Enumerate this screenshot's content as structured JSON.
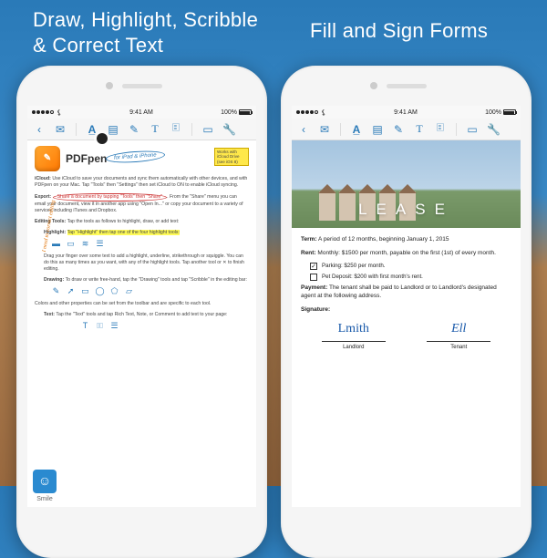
{
  "headlines": {
    "left": "Draw, Highlight, Scribble\n& Correct Text",
    "right": "Fill and Sign Forms"
  },
  "statusbar": {
    "time": "9:41 AM",
    "battery": "100%"
  },
  "toolbar": {
    "items": [
      "back",
      "mail",
      "text-style",
      "highlight",
      "pen",
      "text-tool",
      "note",
      "ruler",
      "wrench"
    ]
  },
  "doc_left": {
    "app_name": "PDFpen",
    "handwritten_tag": "for iPad & iPhone",
    "badge": "Works with iCloud Drive (see iOS 8)",
    "section_icloud_label": "iCloud:",
    "section_icloud": "Use iCloud to save your documents and sync them automatically with other devices, and with PDFpen on your Mac. Tap \"Tools\" then \"Settings\" then set iCloud to ON to enable iCloud syncing.",
    "section_export_label": "Export:",
    "export_link": "Share a document by tapping \"Tools\" then \"Share\"",
    "section_export_tail": ". From the \"Share\" menu you can email your document, view it in another app using \"Open In...\" or copy your document to a variety of services including iTunes and Dropbox.",
    "margin_note": "I need to correct editing",
    "section_editing_label": "Editing Tools:",
    "section_editing": "Tap the tools as follows to highlight, draw, or add text:",
    "highlight_label": "Highlight:",
    "highlight_text": "Tap \"Highlight\" then tap one of the four highlight tools:",
    "highlight_body": "Drag your finger over some text to add a highlight, underline, strikethrough or squiggle. You can do this as many times as you want, with any of the highlight tools. Tap another tool or ✕ to finish editing.",
    "drawing_label": "Drawing:",
    "drawing_text": "To draw or write free-hand, tap the \"Drawing\" tools and tap \"Scribble\" in the editing bar:",
    "colors_text": "Colors and other properties can be set from the toolbar and are specific to each tool.",
    "text_label": "Text:",
    "text_text": "Tap the \"Text\" tools and tap Rich Text, Note, or Comment to add text to your page:",
    "smile_brand": "Smile"
  },
  "doc_right": {
    "lease_title": "LEASE",
    "term_label": "Term:",
    "term": "A period of 12 months, beginning January 1, 2015",
    "rent_label": "Rent:",
    "rent": "Monthly: $1500 per month, payable on the first (1st) of every month.",
    "parking_checked": true,
    "parking": "Parking: $250 per month.",
    "deposit_checked": false,
    "deposit": "Pet Deposit: $200 with first month's rent.",
    "payment_label": "Payment:",
    "payment": "The tenant shall be paid to Landlord or to Landlord's designated agent at the following address.",
    "signature_label": "Signature:",
    "landlord_sig": "Landlord",
    "tenant_sig": "Tenant",
    "sig_landlord_scribble": "Lmith",
    "sig_tenant_scribble": "Ell"
  }
}
